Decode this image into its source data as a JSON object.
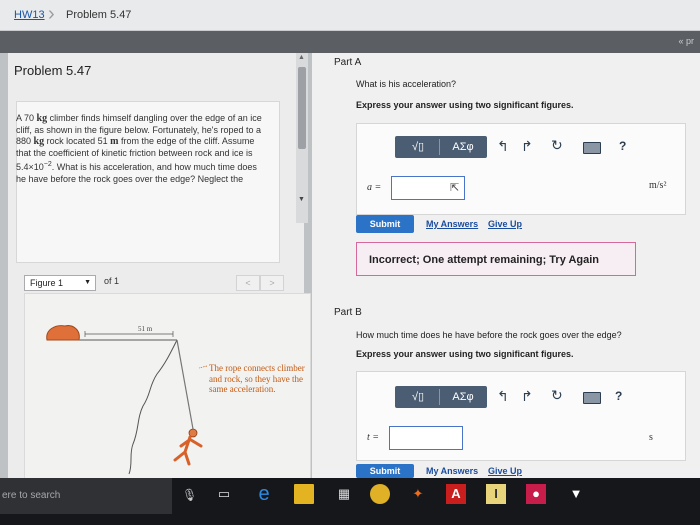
{
  "breadcrumb": {
    "hw": "HW13",
    "problem": "Problem 5.47"
  },
  "strip": {
    "link": "« pr"
  },
  "problem": {
    "title": "Problem 5.47",
    "text_parts": [
      "A 70 ",
      "kg",
      " climber finds himself dangling over the edge of an ice cliff, as shown in the figure below. Fortunately, he's roped to a 880 ",
      "kg",
      " rock located 51 ",
      "m",
      " from the edge of the cliff. Assume that the coefficient of kinetic friction between rock and ice is 5.4×10",
      "−2",
      ". What is his acceleration, and how much time does he have before the rock goes over the edge? Neglect the"
    ]
  },
  "figure": {
    "select_label": "Figure 1",
    "of_label": "of 1",
    "prev": "<",
    "next": ">",
    "distance": "51 m",
    "caption": "The rope connects climber and rock, so they have the same acceleration."
  },
  "partA": {
    "label": "Part A",
    "question": "What is his acceleration?",
    "instruction": "Express your answer using two significant figures.",
    "toolbar": {
      "sqrt": "√▯",
      "sym": "ΑΣφ",
      "help": "?"
    },
    "var": "a =",
    "unit": "m/s²",
    "submit": "Submit",
    "my_answers": "My Answers",
    "give_up": "Give Up",
    "feedback": "Incorrect; One attempt remaining; Try Again"
  },
  "partB": {
    "label": "Part B",
    "question": "How much time does he have before the rock goes over the edge?",
    "instruction": "Express your answer using two significant figures.",
    "toolbar": {
      "sqrt": "√▯",
      "sym": "ΑΣφ",
      "help": "?"
    },
    "var": "t =",
    "unit": "s",
    "submit": "Submit",
    "my_answers": "My Answers",
    "give_up": "Give Up"
  },
  "taskbar": {
    "search": "ere to search"
  },
  "colors": {
    "accent": "#2b73c6",
    "toolbar": "#4a5d72",
    "feedback_border": "#d56a9a",
    "caption": "#c55a11"
  }
}
